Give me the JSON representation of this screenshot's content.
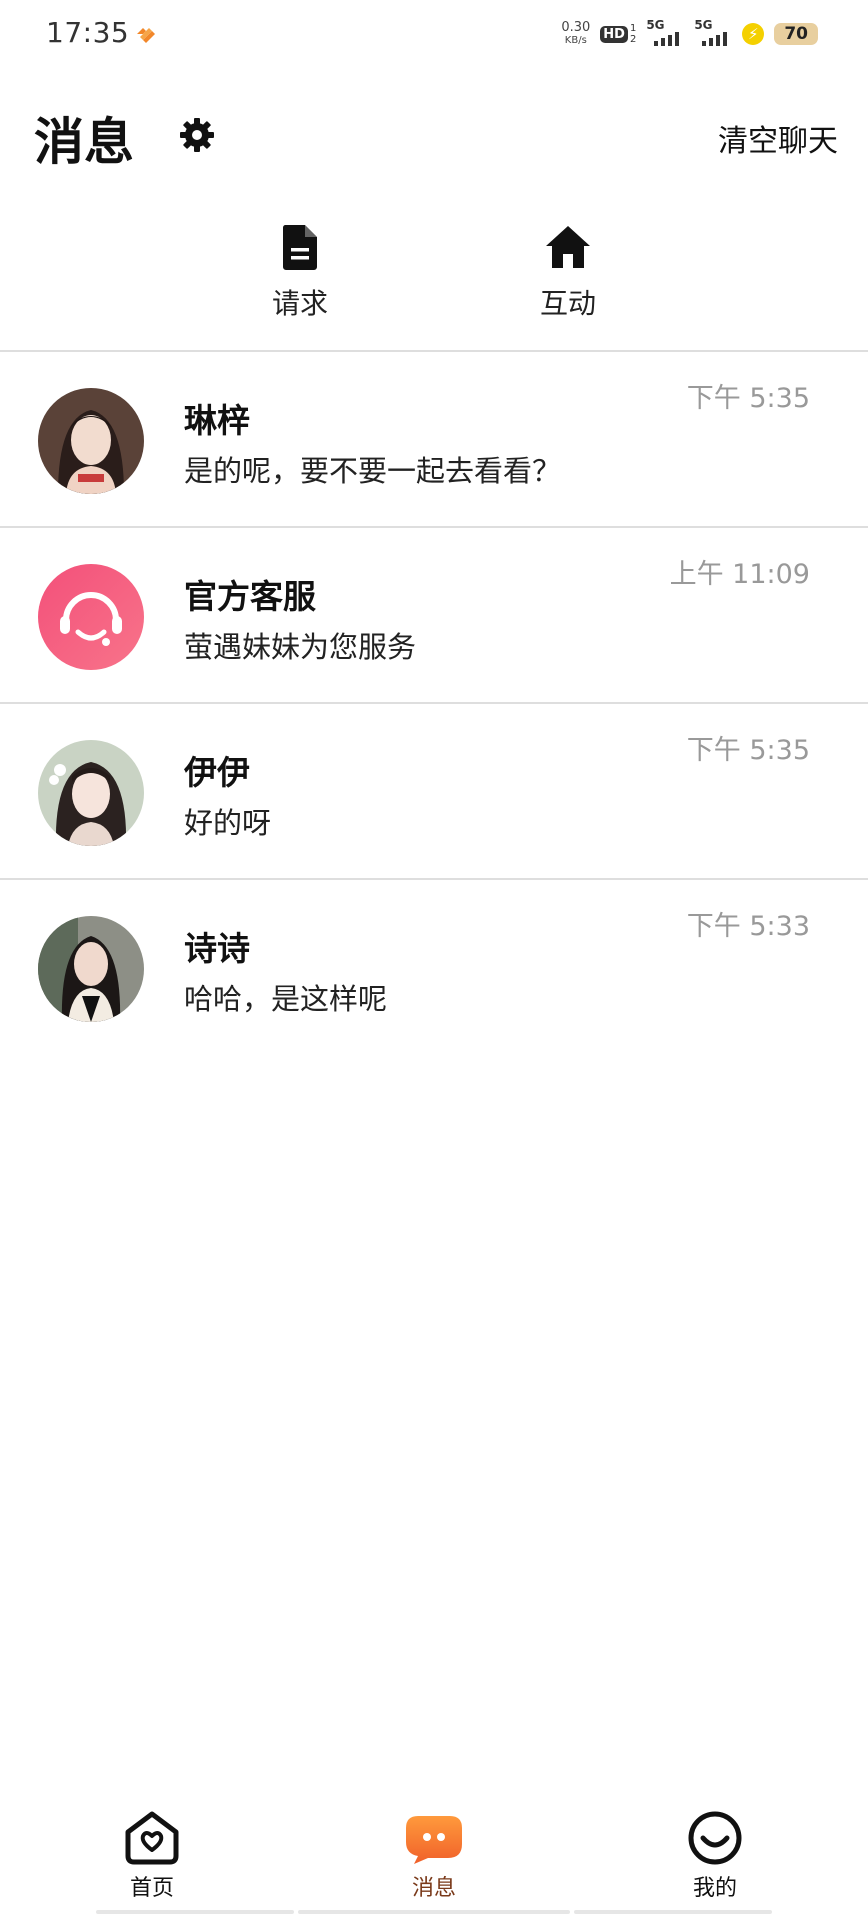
{
  "status_bar": {
    "time": "17:35",
    "net_speed_value": "0.30",
    "net_speed_unit": "KB/s",
    "hd_label": "HD",
    "hd_sims": "1\n2",
    "signal1_label": "5G",
    "signal2_label": "5G",
    "battery": "70"
  },
  "header": {
    "title": "消息",
    "clear_chat": "清空聊天"
  },
  "quick_tabs": [
    {
      "label": "请求",
      "icon": "document-icon"
    },
    {
      "label": "互动",
      "icon": "home-icon"
    }
  ],
  "conversations": [
    {
      "name": "琳梓",
      "message": "是的呢，要不要一起去看看？",
      "time": "下午 5:35"
    },
    {
      "name": "官方客服",
      "message": "萤遇妹妹为您服务",
      "time": "上午 11:09"
    },
    {
      "name": "伊伊",
      "message": "好的呀",
      "time": "下午 5:35"
    },
    {
      "name": "诗诗",
      "message": "哈哈，是这样呢",
      "time": "下午 5:33"
    }
  ],
  "bottom_nav": [
    {
      "label": "首页",
      "icon": "home-heart-icon"
    },
    {
      "label": "消息",
      "icon": "chat-bubble-icon",
      "active": true
    },
    {
      "label": "我的",
      "icon": "smiley-icon"
    }
  ],
  "colors": {
    "accent_orange": "#f2762a",
    "service_pink": "#f45a7d",
    "divider": "#dedede",
    "time_gray": "#999999"
  }
}
